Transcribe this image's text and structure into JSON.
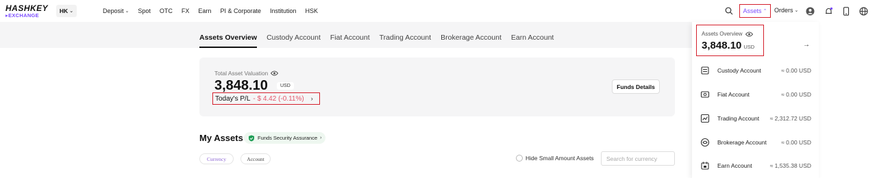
{
  "brand": {
    "name": "HASHKEY",
    "sub": "EXCHANGE",
    "color": "#7c4dff"
  },
  "region": {
    "label": "HK"
  },
  "nav": {
    "items": [
      "Deposit",
      "Spot",
      "OTC",
      "FX",
      "Earn",
      "PI & Corporate",
      "Institution",
      "HSK"
    ],
    "assets_label": "Assets",
    "orders_label": "Orders",
    "icons": [
      "search-icon",
      "user-icon",
      "bell-icon",
      "mobile-icon",
      "globe-icon"
    ]
  },
  "tabs": [
    "Assets Overview",
    "Custody Account",
    "Fiat Account",
    "Trading Account",
    "Brokerage Account",
    "Earn Account"
  ],
  "valuation": {
    "label": "Total Asset Valuation",
    "value": "3,848.10",
    "unit": "USD",
    "pl_label": "Today's P/L",
    "pl_value": "- $ 4.42 (-0.11%)",
    "funds_details_label": "Funds Details"
  },
  "my_assets": {
    "title": "My Assets",
    "badge": "Funds Security Assurance",
    "pill_currency": "Currency",
    "pill_account": "Account",
    "hide_small": "Hide Small Amount Assets",
    "search_placeholder": "Search for currency"
  },
  "dropdown": {
    "label": "Assets Overview",
    "value": "3,848.10",
    "unit": "USD",
    "items": [
      {
        "name": "Custody Account",
        "value": "≈ 0.00 USD",
        "icon": "custody-icon"
      },
      {
        "name": "Fiat Account",
        "value": "≈ 0.00 USD",
        "icon": "fiat-icon"
      },
      {
        "name": "Trading Account",
        "value": "≈ 2,312.72 USD",
        "icon": "trading-icon"
      },
      {
        "name": "Brokerage Account",
        "value": "≈ 0.00 USD",
        "icon": "brokerage-icon"
      },
      {
        "name": "Earn Account",
        "value": "≈ 1,535.38 USD",
        "icon": "earn-icon"
      }
    ]
  },
  "colors": {
    "accent": "#7c4dff",
    "highlight_border": "#d4202c",
    "loss": "#e5566a",
    "panel_bg": "#f5f5f6"
  }
}
